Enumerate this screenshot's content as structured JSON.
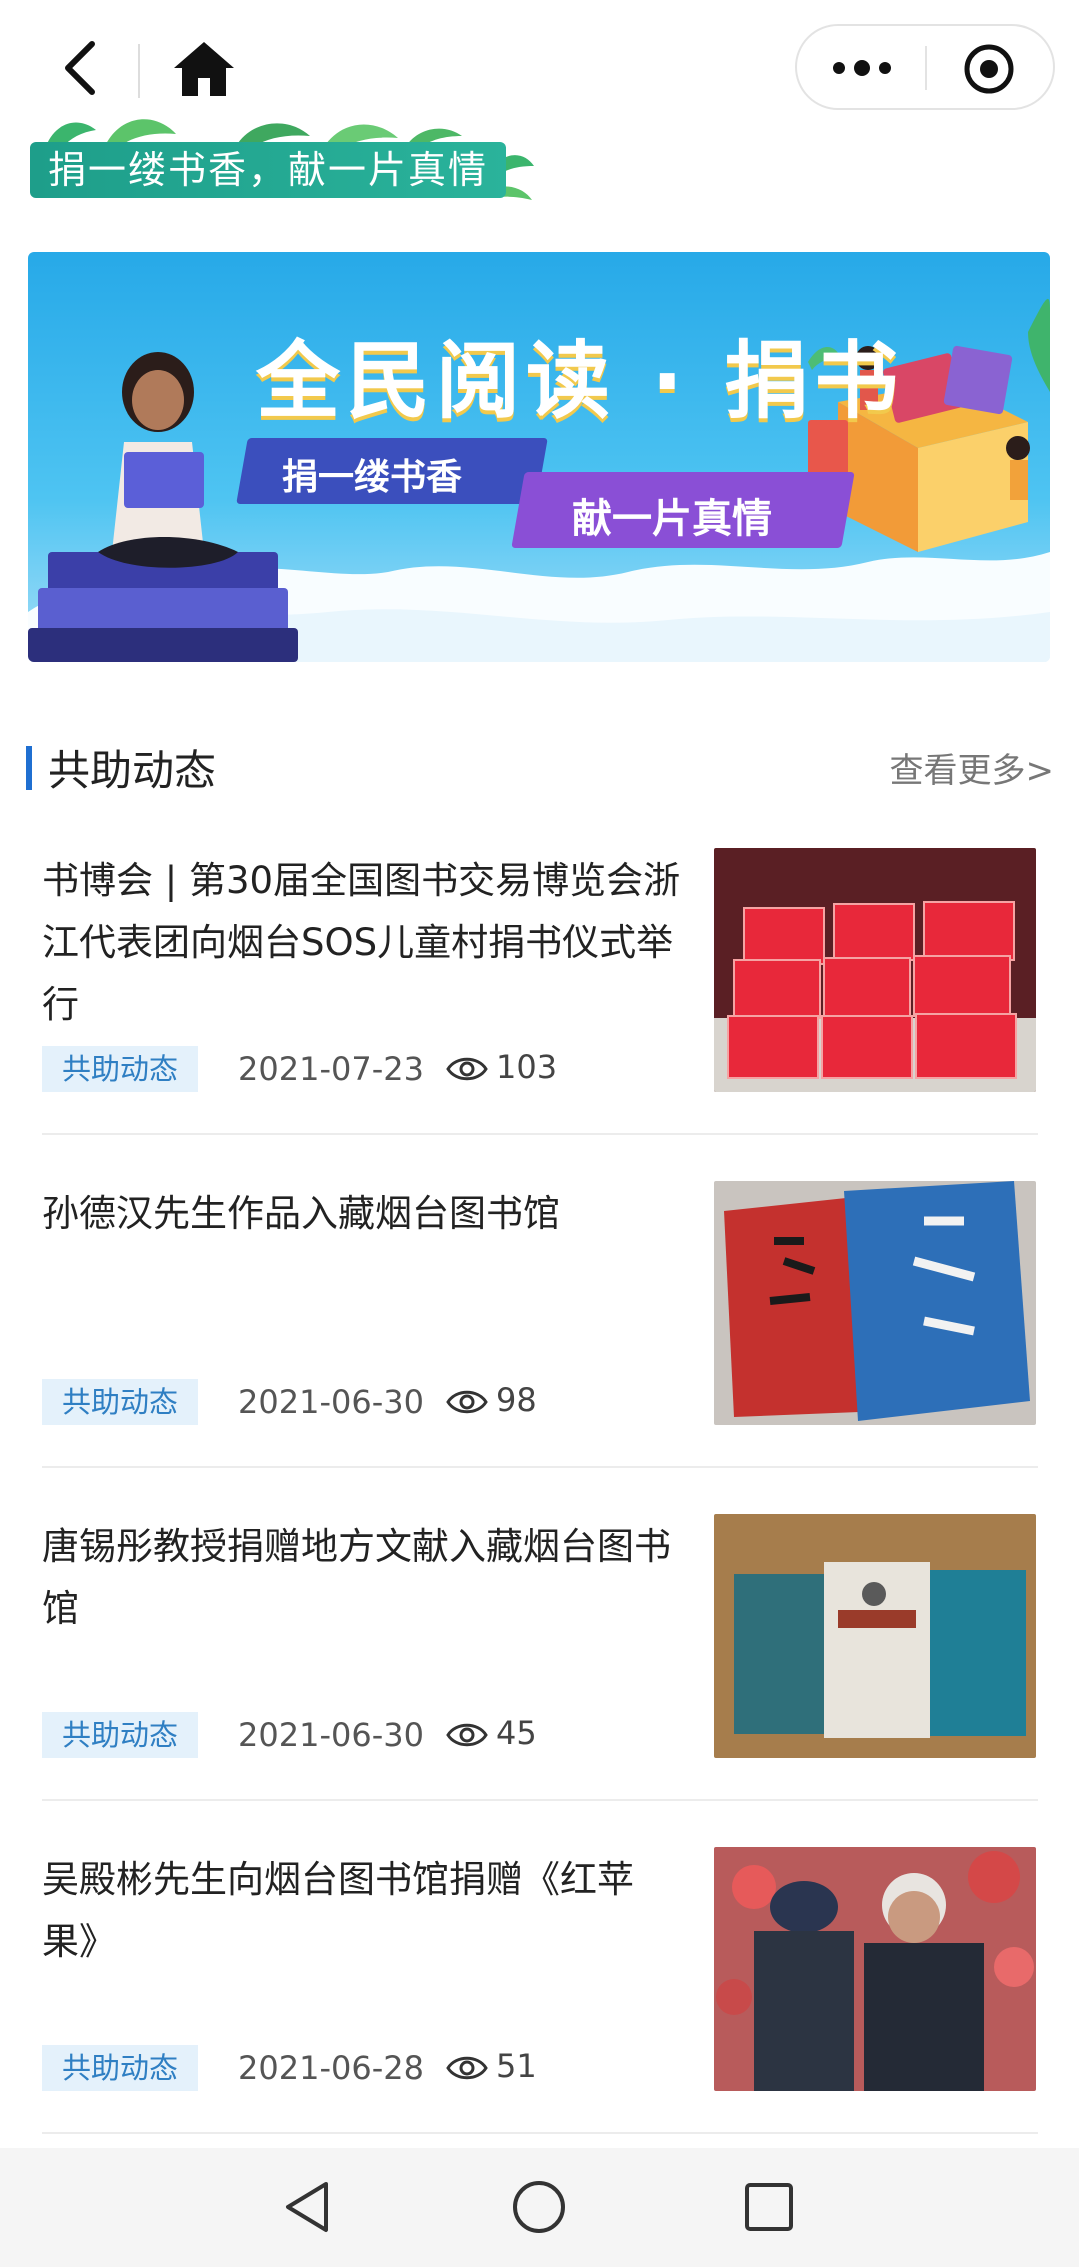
{
  "slogan": {
    "text": "捐一缕书香，献一片真情"
  },
  "hero": {
    "title": "全民阅读 · 捐书",
    "tag1": "捐一缕书香",
    "tag2": "献一片真情"
  },
  "section": {
    "title": "共助动态",
    "more": "查看更多>"
  },
  "news": [
    {
      "title": "书博会 | 第30届全国图书交易博览会浙江代表团向烟台SOS儿童村捐书仪式举行",
      "tag": "共助动态",
      "date": "2021-07-23",
      "views": "103"
    },
    {
      "title": "孙德汉先生作品入藏烟台图书馆",
      "tag": "共助动态",
      "date": "2021-06-30",
      "views": "98"
    },
    {
      "title": "唐锡彤教授捐赠地方文献入藏烟台图书馆",
      "tag": "共助动态",
      "date": "2021-06-30",
      "views": "45"
    },
    {
      "title": "吴殿彬先生向烟台图书馆捐赠《红苹果》",
      "tag": "共助动态",
      "date": "2021-06-28",
      "views": "51"
    }
  ],
  "colors": {
    "accent": "#1f6fd1",
    "tag_bg": "#e4f1fb",
    "tag_text": "#2f7fc3",
    "slogan_green": "#1e9e8a",
    "hero_blue": "#27a9e8"
  },
  "icons": {
    "back": "back-arrow-icon",
    "home": "home-icon",
    "more": "more-dots-icon",
    "target": "target-icon",
    "views": "eye-icon"
  }
}
